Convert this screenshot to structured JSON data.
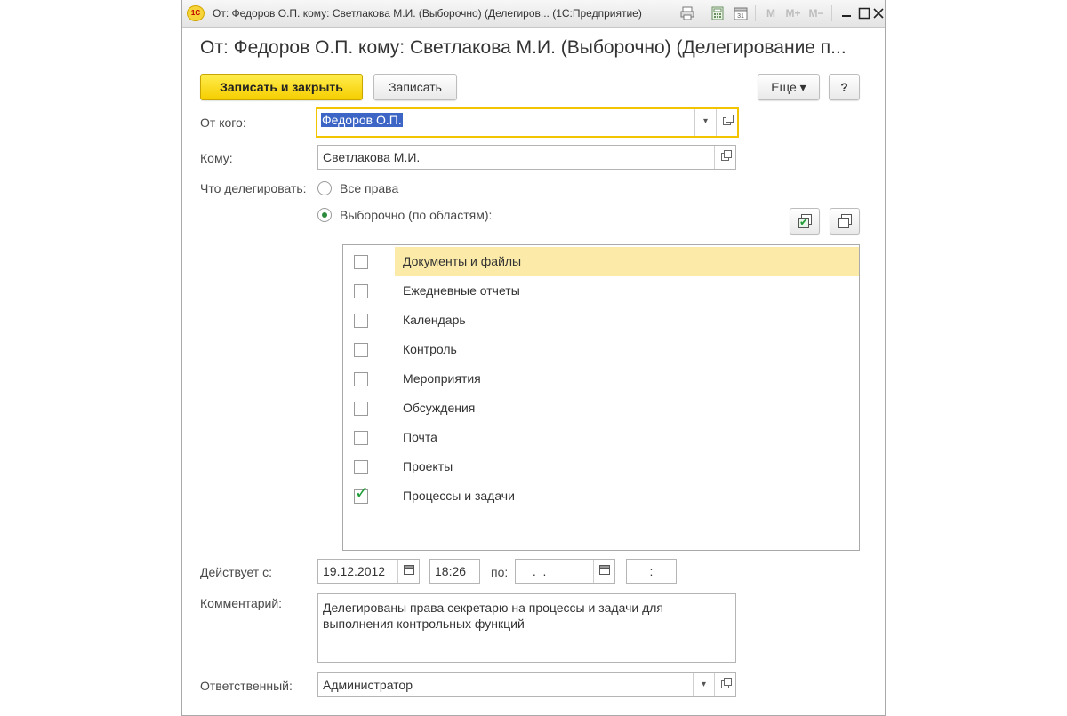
{
  "window": {
    "app_logo": "1С",
    "title": "От: Федоров О.П. кому: Светлакова М.И. (Выборочно) (Делегиров...  (1С:Предприятие)",
    "toolbar": {
      "m_label": "M",
      "m_plus_label": "M+",
      "m_minus_label": "M−"
    }
  },
  "form": {
    "title": "От: Федоров О.П. кому: Светлакова М.И. (Выборочно) (Делегирование п..."
  },
  "toolbar": {
    "save_close_label": "Записать и закрыть",
    "save_label": "Записать",
    "more_label": "Еще ▾",
    "help_label": "?"
  },
  "fields": {
    "from_label": "От кого:",
    "from_value": "Федоров О.П.",
    "to_label": "Кому:",
    "to_value": "Светлакова М.И.",
    "what_label": "Что делегировать:",
    "all_rights_label": "Все права",
    "selective_label": "Выборочно (по областям):",
    "valid_from_label": "Действует с:",
    "date_from": "19.12.2012",
    "time_from": "18:26",
    "to_date_label": "по:",
    "date_to": " .  .",
    "time_to": ":",
    "comment_label": "Комментарий:",
    "comment_value": "Делегированы права секретарю на процессы и задачи для выполнения контрольных функций",
    "responsible_label": "Ответственный:",
    "responsible_value": "Администратор"
  },
  "areas": [
    {
      "label": "Документы и файлы",
      "checked": false,
      "selected": true
    },
    {
      "label": "Ежедневные отчеты",
      "checked": false,
      "selected": false
    },
    {
      "label": "Календарь",
      "checked": false,
      "selected": false
    },
    {
      "label": "Контроль",
      "checked": false,
      "selected": false
    },
    {
      "label": "Мероприятия",
      "checked": false,
      "selected": false
    },
    {
      "label": "Обсуждения",
      "checked": false,
      "selected": false
    },
    {
      "label": "Почта",
      "checked": false,
      "selected": false
    },
    {
      "label": "Проекты",
      "checked": false,
      "selected": false
    },
    {
      "label": "Процессы и задачи",
      "checked": true,
      "selected": false
    }
  ],
  "colors": {
    "primary_button": "#f5ce00",
    "focus_border": "#f2c500",
    "selected_row": "#fbeaa8",
    "check_green": "#1f9c36",
    "text_selection": "#3c65c5"
  }
}
